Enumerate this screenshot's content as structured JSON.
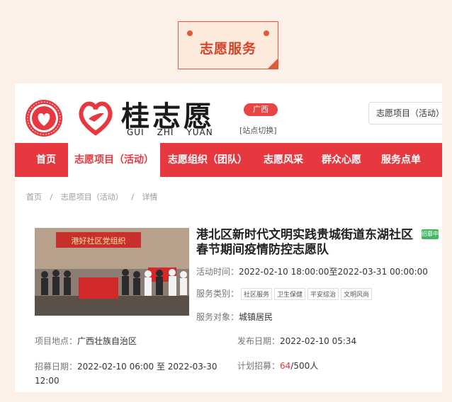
{
  "section_badge": "志愿服务",
  "header": {
    "logo_cn": "桂志愿",
    "logo_en": [
      "GUI",
      "ZHI",
      "YUAN"
    ],
    "region": "广西",
    "switch_label": "[站点切换]",
    "search_value": "志愿项目（活动）"
  },
  "nav": {
    "items": [
      "首页",
      "志愿项目（活动）",
      "志愿组织（团队）",
      "志愿风采",
      "群众心愿",
      "服务点单"
    ],
    "active_index": 1
  },
  "breadcrumb": [
    "首页",
    "/",
    "志愿项目（活动）",
    "/",
    "详情"
  ],
  "project": {
    "title": "港北区新时代文明实践贵城街道东湖社区春节期间疫情防控志愿队",
    "status": "招募中",
    "time_label": "活动时间：",
    "time_value": "2022-02-10 18:00:00至2022-03-31 00:00:00",
    "category_label": "服务类别：",
    "categories": [
      "社区服务",
      "卫生保健",
      "平安综治",
      "文明风尚"
    ],
    "target_label": "服务对象：",
    "target_value": "城镇居民",
    "location_label": "项目地点：",
    "location_value": "广西壮族自治区",
    "publish_label": "发布日期：",
    "publish_value": "2022-02-10 05:34",
    "recruit_label": "招募日期：",
    "recruit_value": "2022-02-10 06:00 至 2022-03-30 12:00",
    "plan_label": "计划招募：",
    "plan_current": "64",
    "plan_total": "/500人",
    "photo_banner": "港好社区党组织"
  },
  "colors": {
    "accent": "#e7383f",
    "badge": "#e05a3a",
    "background": "#fbf1e8"
  }
}
